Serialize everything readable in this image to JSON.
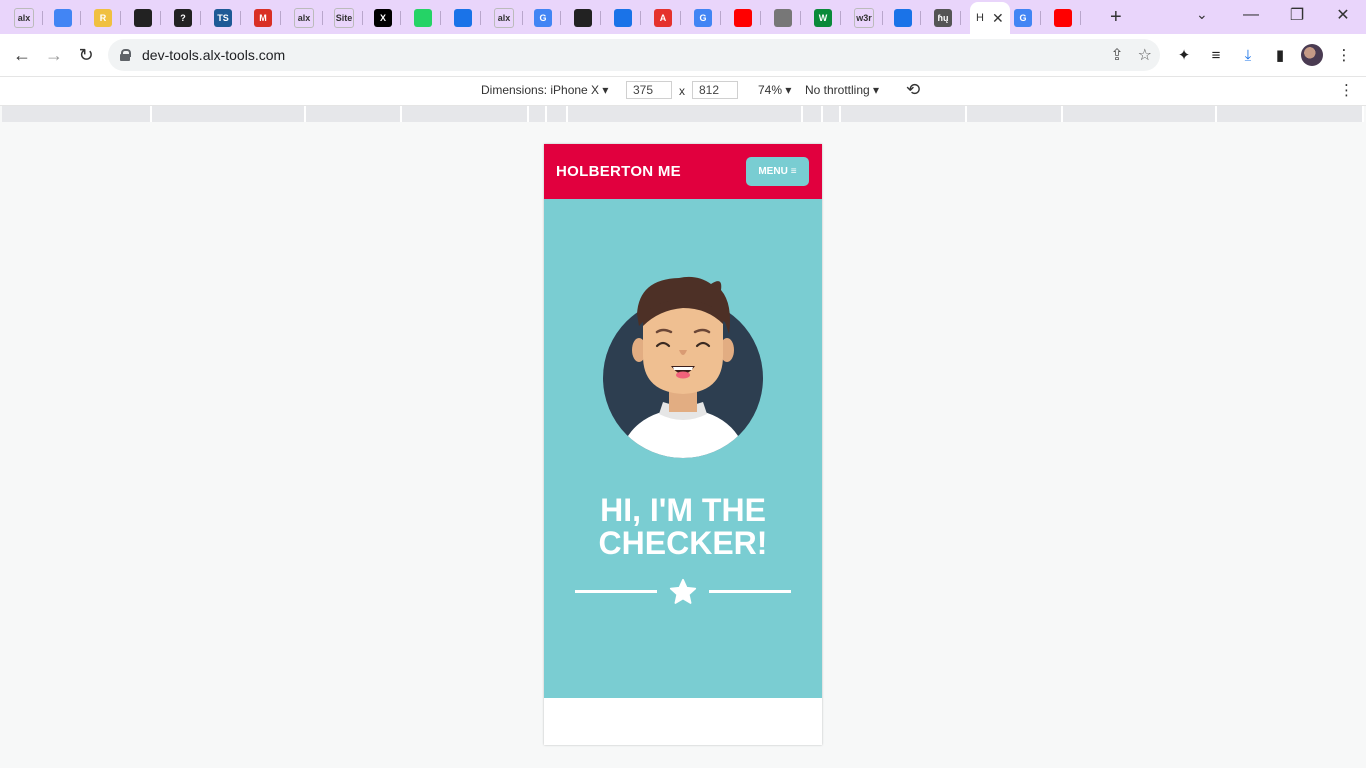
{
  "browser": {
    "tabs": [
      {
        "icon": "alx-icon",
        "text": "alx",
        "color": "#ffffff"
      },
      {
        "icon": "chrome-icon",
        "text": "",
        "color": "#4285f4"
      },
      {
        "icon": "r-icon",
        "text": "R",
        "color": "#f0c040"
      },
      {
        "icon": "github-icon",
        "text": "",
        "color": "#222222"
      },
      {
        "icon": "help-icon",
        "text": "?",
        "color": "#222222"
      },
      {
        "icon": "ts-icon",
        "text": "TS",
        "color": "#1e5a96"
      },
      {
        "icon": "gmail-icon",
        "text": "M",
        "color": "#d93025"
      },
      {
        "icon": "alx-icon",
        "text": "alx",
        "color": "#ffffff"
      },
      {
        "icon": "site-icon",
        "text": "Site",
        "color": "#ffffff"
      },
      {
        "icon": "x-icon",
        "text": "X",
        "color": "#000000"
      },
      {
        "icon": "whatsapp-icon",
        "text": "",
        "color": "#25d366"
      },
      {
        "icon": "circle-icon",
        "text": "",
        "color": "#1a73e8"
      },
      {
        "icon": "alx-icon",
        "text": "alx",
        "color": "#ffffff"
      },
      {
        "icon": "google-icon",
        "text": "G",
        "color": "#4285f4"
      },
      {
        "icon": "github-icon",
        "text": "",
        "color": "#222222"
      },
      {
        "icon": "gear-icon",
        "text": "",
        "color": "#1a73e8"
      },
      {
        "icon": "acrobat-icon",
        "text": "A",
        "color": "#e5322d"
      },
      {
        "icon": "google-icon",
        "text": "G",
        "color": "#4285f4"
      },
      {
        "icon": "youtube-icon",
        "text": "",
        "color": "#ff0000"
      },
      {
        "icon": "globe-icon",
        "text": "",
        "color": "#777777"
      },
      {
        "icon": "w-icon",
        "text": "W",
        "color": "#0a8a3a"
      },
      {
        "icon": "w3-icon",
        "text": "w3r",
        "color": "#cccccc"
      },
      {
        "icon": "download-icon",
        "text": "",
        "color": "#1a73e8"
      },
      {
        "icon": "ntu-icon",
        "text": "ɦų",
        "color": "#555555"
      }
    ],
    "active_tab": {
      "title": "H"
    },
    "after_tabs": [
      {
        "icon": "google-icon",
        "text": "G",
        "color": "#4285f4"
      },
      {
        "icon": "youtube-icon",
        "text": "",
        "color": "#ff0000"
      }
    ],
    "url": "dev-tools.alx-tools.com"
  },
  "devtools": {
    "dimensions_label": "Dimensions: iPhone X",
    "width": "375",
    "height": "812",
    "times": "x",
    "zoom": "74%",
    "throttling": "No throttling"
  },
  "site": {
    "title": "HOLBERTON ME",
    "menu_label": "MENU",
    "hero_line1": "HI, I'M THE",
    "hero_line2": "CHECKER!",
    "colors": {
      "header": "#e1003e",
      "hero": "#7acdd2"
    }
  }
}
